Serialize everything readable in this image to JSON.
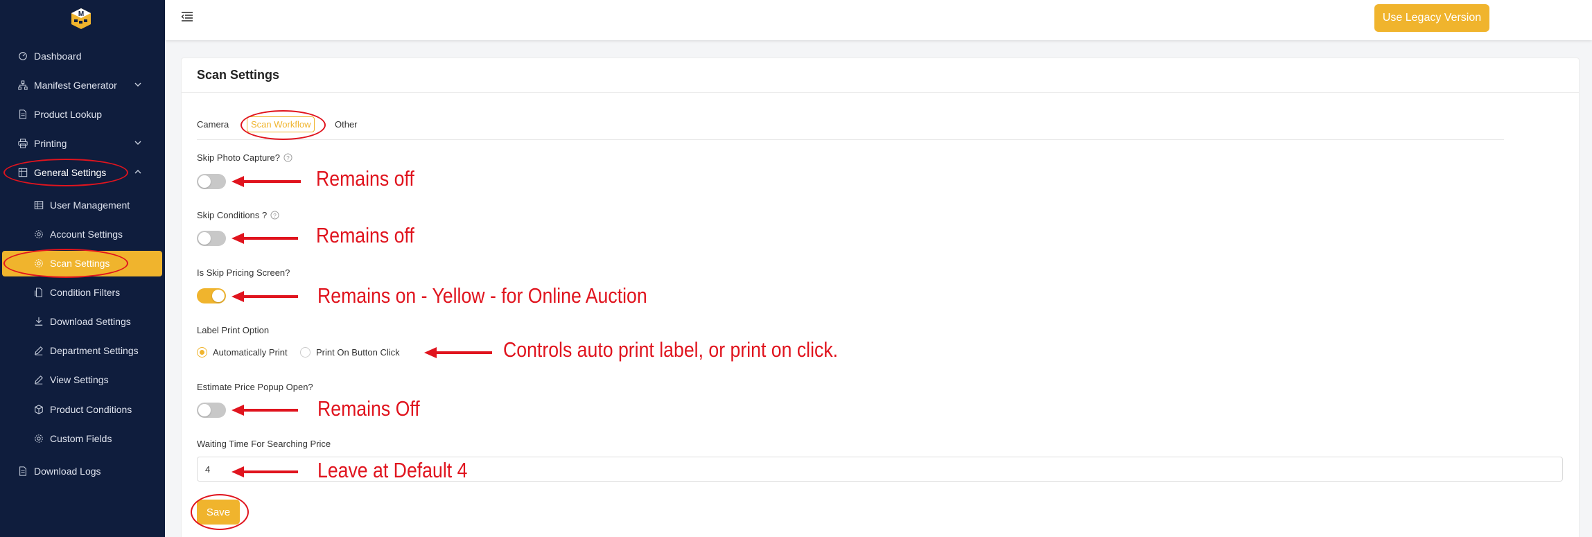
{
  "sidebar": {
    "logo_icon": "m-cube-logo",
    "items": [
      {
        "label": "Dashboard",
        "icon": "dashboard-icon"
      },
      {
        "label": "Manifest Generator",
        "icon": "sitemap-icon"
      },
      {
        "label": "Product Lookup",
        "icon": "file-icon"
      },
      {
        "label": "Printing",
        "icon": "printer-icon"
      },
      {
        "label": "General Settings",
        "icon": "grid-icon"
      },
      {
        "label": "User Management",
        "icon": "table-icon"
      },
      {
        "label": "Account Settings",
        "icon": "gear-icon"
      },
      {
        "label": "Scan Settings",
        "icon": "gear-icon"
      },
      {
        "label": "Condition Filters",
        "icon": "filter-doc-icon"
      },
      {
        "label": "Download Settings",
        "icon": "download-icon"
      },
      {
        "label": "Department Settings",
        "icon": "edit-icon"
      },
      {
        "label": "View Settings",
        "icon": "edit-icon"
      },
      {
        "label": "Product Conditions",
        "icon": "cube-icon"
      },
      {
        "label": "Custom Fields",
        "icon": "gear-icon"
      },
      {
        "label": "Download Logs",
        "icon": "file-icon"
      }
    ],
    "active": "Scan Settings",
    "background": "#0f1d3d",
    "accent": "#f0b42d"
  },
  "header": {
    "legacy_button": "Use Legacy Version"
  },
  "main": {
    "title": "Scan Settings",
    "tabs": [
      {
        "label": "Camera",
        "active": false
      },
      {
        "label": "Scan Workflow",
        "active": true
      },
      {
        "label": "Other",
        "active": false
      }
    ],
    "fields": {
      "skip_photo": {
        "label": "Skip Photo Capture?",
        "value": false
      },
      "skip_conditions": {
        "label": "Skip Conditions ?",
        "value": false
      },
      "skip_pricing": {
        "label": "Is Skip Pricing Screen?",
        "value": true
      },
      "label_print": {
        "label": "Label Print Option",
        "options": [
          "Automatically Print",
          "Print On Button Click"
        ],
        "selected": "Automatically Print"
      },
      "estimate_popup": {
        "label": "Estimate Price Popup Open?",
        "value": false
      },
      "waiting_time": {
        "label": "Waiting Time For Searching Price",
        "value": "4"
      }
    },
    "save_label": "Save"
  },
  "annotations": {
    "skip_photo_note": "Remains off",
    "skip_conditions_note": "Remains off",
    "skip_pricing_note": "Remains on - Yellow - for Online Auction",
    "label_print_note": "Controls auto print label, or print on click.",
    "estimate_popup_note": "Remains Off",
    "waiting_time_note": "Leave at Default 4",
    "color": "#e0141e"
  }
}
